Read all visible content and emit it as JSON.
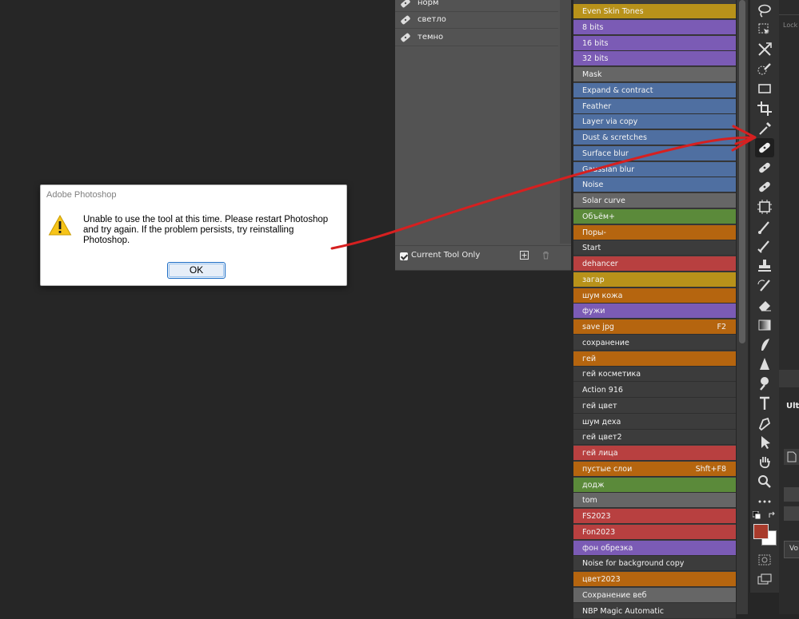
{
  "dialog": {
    "title": "Adobe Photoshop",
    "icon": "warning-icon",
    "message": "Unable to use the tool at this time. Please restart Photoshop and try again. If the problem persists, try reinstalling Photoshop.",
    "ok_label": "OK"
  },
  "presets_panel": {
    "items": [
      {
        "label": "норм"
      },
      {
        "label": "светло"
      },
      {
        "label": "темно"
      }
    ],
    "current_tool_only_label": "Current Tool Only",
    "current_tool_only_checked": true
  },
  "actions_panel": {
    "items": [
      {
        "label": "Even Skin Tones",
        "color": "#b8921a",
        "shortcut": ""
      },
      {
        "label": "8 bits",
        "color": "#7b5bb5",
        "shortcut": ""
      },
      {
        "label": "16 bits",
        "color": "#7b5bb5",
        "shortcut": ""
      },
      {
        "label": "32 bits",
        "color": "#7b5bb5",
        "shortcut": ""
      },
      {
        "label": "Mask",
        "color": "#666666",
        "shortcut": ""
      },
      {
        "label": "Expand & contract",
        "color": "#4f6fa1",
        "shortcut": ""
      },
      {
        "label": "Feather",
        "color": "#4f6fa1",
        "shortcut": ""
      },
      {
        "label": "Layer via copy",
        "color": "#4f6fa1",
        "shortcut": ""
      },
      {
        "label": "Dust & scretches",
        "color": "#4f6fa1",
        "shortcut": ""
      },
      {
        "label": "Surface blur",
        "color": "#4f6fa1",
        "shortcut": ""
      },
      {
        "label": "Gaussian blur",
        "color": "#4f6fa1",
        "shortcut": ""
      },
      {
        "label": "Noise",
        "color": "#4f6fa1",
        "shortcut": ""
      },
      {
        "label": "Solar curve",
        "color": "#666666",
        "shortcut": ""
      },
      {
        "label": "Объём+",
        "color": "#5b8a3a",
        "shortcut": ""
      },
      {
        "label": "Поры-",
        "color": "#b5650f",
        "shortcut": ""
      },
      {
        "label": "Start",
        "color": "#3c3c3c",
        "shortcut": ""
      },
      {
        "label": "dehancer",
        "color": "#b84040",
        "shortcut": ""
      },
      {
        "label": "загар",
        "color": "#b8921a",
        "shortcut": ""
      },
      {
        "label": "шум кожа",
        "color": "#b5650f",
        "shortcut": ""
      },
      {
        "label": "фужи",
        "color": "#7b5bb5",
        "shortcut": ""
      },
      {
        "label": "save jpg",
        "color": "#b5650f",
        "shortcut": "F2"
      },
      {
        "label": "сохранение",
        "color": "#3c3c3c",
        "shortcut": ""
      },
      {
        "label": "гей",
        "color": "#b5650f",
        "shortcut": ""
      },
      {
        "label": "гей косметика",
        "color": "#3c3c3c",
        "shortcut": ""
      },
      {
        "label": "Action 916",
        "color": "#3c3c3c",
        "shortcut": ""
      },
      {
        "label": "гей цвет",
        "color": "#3c3c3c",
        "shortcut": ""
      },
      {
        "label": "шум деха",
        "color": "#3c3c3c",
        "shortcut": ""
      },
      {
        "label": "гей цвет2",
        "color": "#3c3c3c",
        "shortcut": ""
      },
      {
        "label": "гей лица",
        "color": "#b84040",
        "shortcut": ""
      },
      {
        "label": "пустые слои",
        "color": "#b5650f",
        "shortcut": "Shft+F8"
      },
      {
        "label": "додж",
        "color": "#5b8a3a",
        "shortcut": ""
      },
      {
        "label": "tom",
        "color": "#666666",
        "shortcut": ""
      },
      {
        "label": "FS2023",
        "color": "#b84040",
        "shortcut": ""
      },
      {
        "label": "Fon2023",
        "color": "#b84040",
        "shortcut": ""
      },
      {
        "label": "фон обрезка",
        "color": "#7b5bb5",
        "shortcut": ""
      },
      {
        "label": "Noise for background copy",
        "color": "#3c3c3c",
        "shortcut": ""
      },
      {
        "label": "цвет2023",
        "color": "#b5650f",
        "shortcut": ""
      },
      {
        "label": "Сохранение веб",
        "color": "#666666",
        "shortcut": ""
      },
      {
        "label": "NBP Magic Automatic",
        "color": "#3c3c3c",
        "shortcut": ""
      }
    ]
  },
  "toolbar": {
    "tools": [
      {
        "name": "lasso-tool-icon"
      },
      {
        "name": "object-selection-tool-icon"
      },
      {
        "name": "move-tool-icon"
      },
      {
        "name": "quick-selection-tool-icon"
      },
      {
        "name": "rectangle-marquee-tool-icon"
      },
      {
        "name": "crop-tool-icon"
      },
      {
        "name": "eyedropper-tool-icon"
      },
      {
        "name": "spot-healing-brush-tool-icon",
        "active": true
      },
      {
        "name": "healing-brush-tool-icon"
      },
      {
        "name": "patch-tool-icon"
      },
      {
        "name": "frame-tool-icon"
      },
      {
        "name": "brush-tool-icon"
      },
      {
        "name": "mixer-brush-tool-icon"
      },
      {
        "name": "clone-stamp-tool-icon"
      },
      {
        "name": "history-brush-tool-icon"
      },
      {
        "name": "eraser-tool-icon"
      },
      {
        "name": "gradient-tool-icon"
      },
      {
        "name": "smudge-tool-icon"
      },
      {
        "name": "sharpen-tool-icon"
      },
      {
        "name": "dodge-tool-icon"
      },
      {
        "name": "type-tool-icon"
      },
      {
        "name": "pen-tool-icon"
      },
      {
        "name": "path-selection-tool-icon"
      },
      {
        "name": "hand-tool-icon"
      },
      {
        "name": "zoom-tool-icon"
      },
      {
        "name": "more-tools-icon"
      }
    ],
    "foreground_color": "#a83b2c",
    "background_color": "#ffffff"
  },
  "right_panel": {
    "lock_label": "Lock",
    "title_fragment": "Ulti",
    "field_fragment": "Vo"
  },
  "annotation": {
    "arrow_color": "#d62020"
  }
}
